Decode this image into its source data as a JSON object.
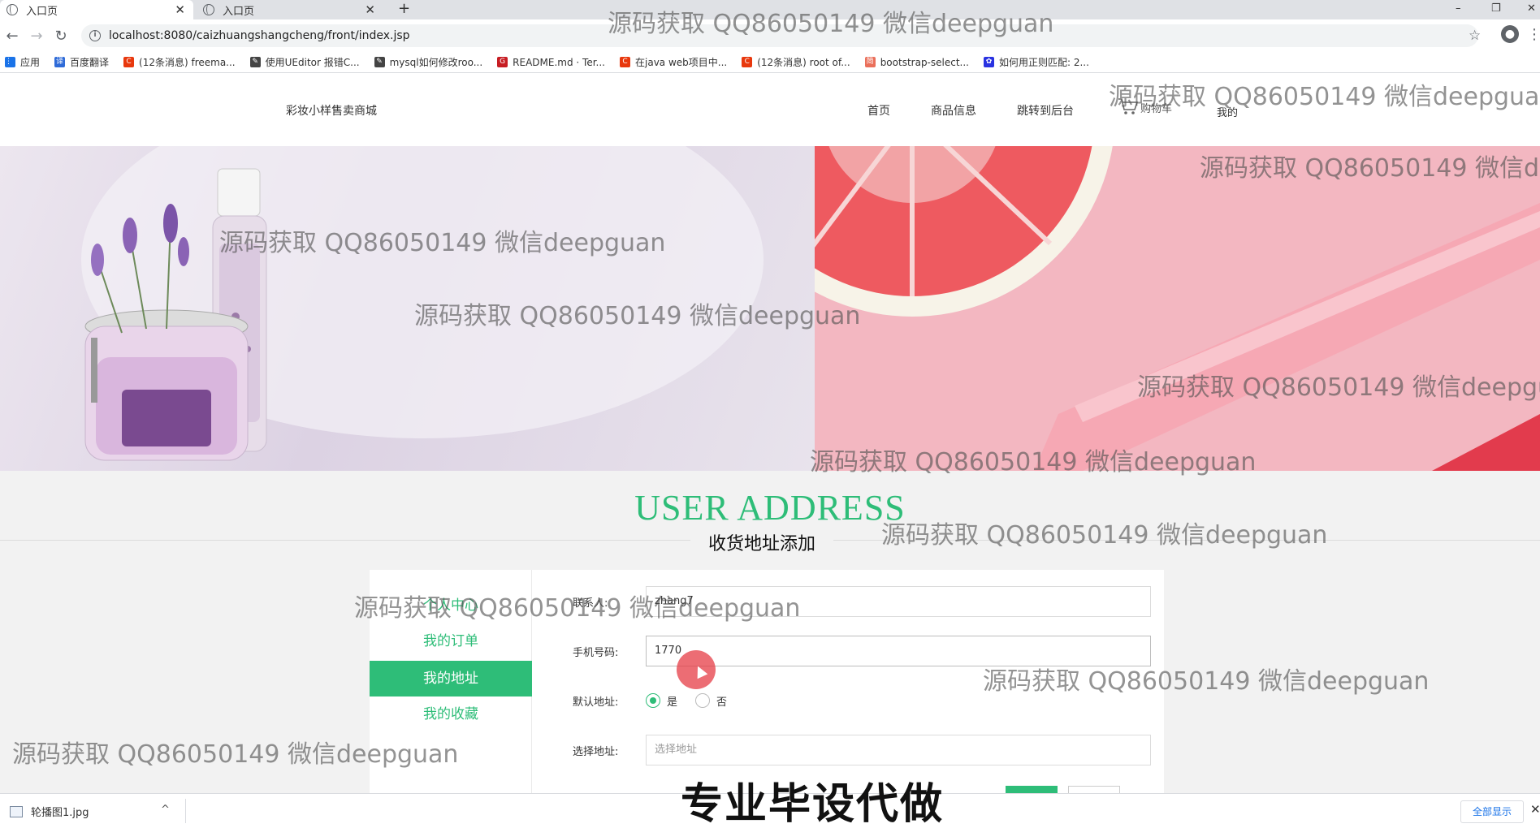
{
  "browser": {
    "tabs": [
      {
        "title": "入口页",
        "close": "✕"
      },
      {
        "title": "入口页",
        "close": "✕"
      }
    ],
    "new_tab": "+",
    "window_controls": {
      "minimize": "–",
      "restore": "❐",
      "close": "✕"
    },
    "url": "localhost:8080/caizhuangshangcheng/front/index.jsp",
    "bookmarks": [
      {
        "label": "应用",
        "icon": "apps-grid-icon",
        "color": "#1a73e8"
      },
      {
        "label": "百度翻译",
        "icon": "translate-icon",
        "color": "#2f6bd8"
      },
      {
        "label": "(12条消息) freema...",
        "icon": "csdn-icon",
        "color": "#e8380d"
      },
      {
        "label": "使用UEditor 报错C...",
        "icon": "cnblogs-icon",
        "color": "#444444"
      },
      {
        "label": "mysql如何修改roo...",
        "icon": "cnblogs-icon",
        "color": "#444444"
      },
      {
        "label": "README.md · Ter...",
        "icon": "gitee-icon",
        "color": "#c71d23"
      },
      {
        "label": "在java web项目中...",
        "icon": "csdn-icon",
        "color": "#e8380d"
      },
      {
        "label": "(12条消息) root of...",
        "icon": "csdn-icon",
        "color": "#e8380d"
      },
      {
        "label": "bootstrap-select...",
        "icon": "jianshu-icon",
        "color": "#ea6f5a"
      },
      {
        "label": "如何用正则匹配: 2...",
        "icon": "baidu-paw-icon",
        "color": "#2932e1"
      }
    ]
  },
  "site": {
    "brand": "彩妆小样售卖商城",
    "nav": [
      "首页",
      "商品信息",
      "跳转到后台"
    ],
    "cart_label": "购物车",
    "mine_label": "我的"
  },
  "section": {
    "title": "USER ADDRESS",
    "subtitle": "收货地址添加"
  },
  "side_menu": [
    {
      "label": "个人中心",
      "active": false
    },
    {
      "label": "我的订单",
      "active": false
    },
    {
      "label": "我的地址",
      "active": true
    },
    {
      "label": "我的收藏",
      "active": false
    }
  ],
  "form": {
    "contact_label": "联系人:",
    "contact_value": "zhang7",
    "phone_label": "手机号码:",
    "phone_value": "1770",
    "default_label": "默认地址:",
    "default_yes": "是",
    "default_no": "否",
    "default_selected": "是",
    "address_label": "选择地址:",
    "address_placeholder": "选择地址"
  },
  "watermarks": {
    "text": "源码获取 QQ86050149 微信deepguan",
    "slogan": "专业毕设代做"
  },
  "download_bar": {
    "file_name": "轮播图1.jpg",
    "show_all": "全部显示",
    "close": "✕",
    "chevron": "^"
  },
  "colors": {
    "accent": "#2ebd78",
    "click_marker": "#e63c46"
  }
}
